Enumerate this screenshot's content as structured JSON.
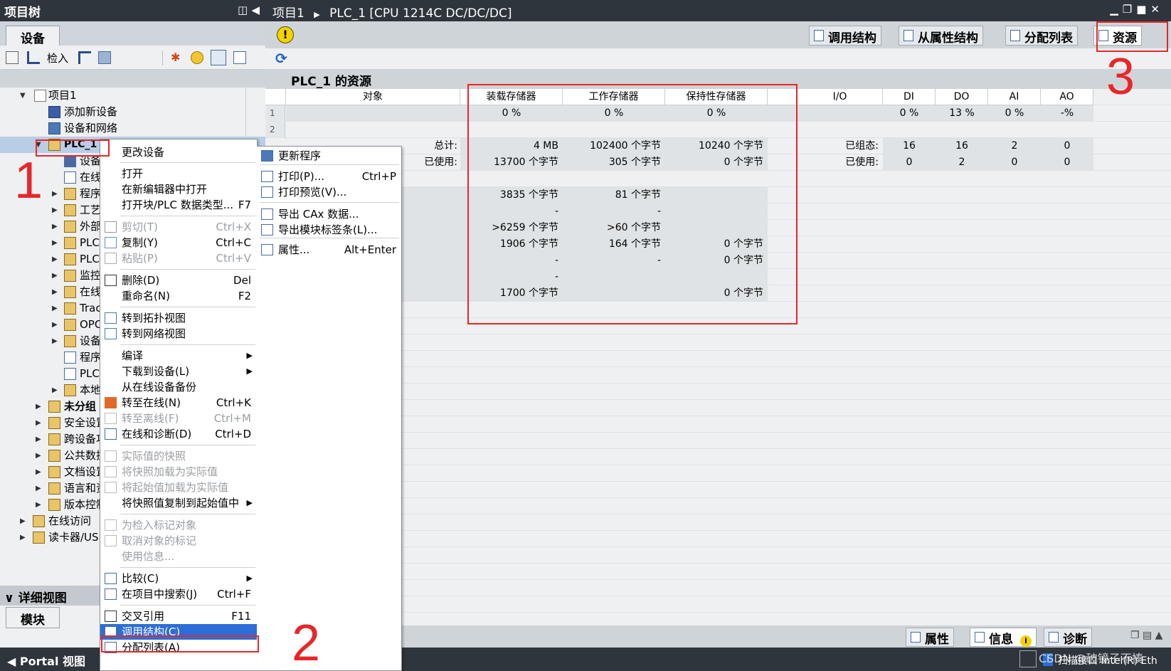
{
  "left_panel": {
    "title": "项目树",
    "tab": "设备",
    "toolbar_checkin": "检入",
    "tree": [
      {
        "label": "项目1"
      },
      {
        "label": "添加新设备"
      },
      {
        "label": "设备和网络"
      },
      {
        "label": "PLC_1 ["
      },
      {
        "label": "设备"
      },
      {
        "label": "在线"
      },
      {
        "label": "程序"
      },
      {
        "label": "工艺"
      },
      {
        "label": "外部"
      },
      {
        "label": "PLC"
      },
      {
        "label": "PLC"
      },
      {
        "label": "监控"
      },
      {
        "label": "在线"
      },
      {
        "label": "Trac"
      },
      {
        "label": "OPC"
      },
      {
        "label": "设备"
      },
      {
        "label": "程序"
      },
      {
        "label": "PLC"
      },
      {
        "label": "本地"
      },
      {
        "label": "未分组"
      },
      {
        "label": "安全设置"
      },
      {
        "label": "跨设备功"
      },
      {
        "label": "公共数据"
      },
      {
        "label": "文档设置"
      },
      {
        "label": "语言和资"
      },
      {
        "label": "版本控制"
      },
      {
        "label": "在线访问"
      },
      {
        "label": "读卡器/USE"
      }
    ],
    "detail_title": "详细视图",
    "detail_tab": "模块",
    "portal_label": "Portal 视图"
  },
  "editor": {
    "breadcrumb_project": "项目1",
    "breadcrumb_device": "PLC_1 [CPU 1214C DC/DC/DC]",
    "tabs": [
      "调用结构",
      "从属性结构",
      "分配列表",
      "资源"
    ],
    "title": "PLC_1 的资源",
    "columns": [
      "对象",
      "装载存储器",
      "工作存储器",
      "保持性存储器",
      "I/O",
      "DI",
      "DO",
      "AI",
      "AO"
    ],
    "row1": {
      "rownum": "1",
      "load": "0 %",
      "work": "0 %",
      "retain": "0 %",
      "di": "0 %",
      "do": "13 %",
      "ai": "0 %",
      "ao": "-%"
    },
    "row2": {
      "rownum": "2"
    },
    "total_label": "总计:",
    "used_label": "已使用:",
    "configured_label": "已组态:",
    "io_used_label": "已使用:",
    "total": {
      "load": "4 MB",
      "work": "102400 个字节",
      "retain": "10240 个字节"
    },
    "used": {
      "load": "13700 个字节",
      "work": "305 个字节",
      "retain": "0 个字节"
    },
    "configured": {
      "di": "16",
      "do": "16",
      "ai": "2",
      "ao": "0"
    },
    "io_used": {
      "di": "0",
      "do": "2",
      "ai": "0",
      "ao": "0"
    },
    "detail_rows": [
      {
        "load": "3835 个字节",
        "work": "81 个字节",
        "retain": ""
      },
      {
        "load": "-",
        "work": "-",
        "retain": ""
      },
      {
        "load": ">6259 个字节",
        "work": ">60 个字节",
        "retain": ""
      },
      {
        "load": "1906 个字节",
        "work": "164 个字节",
        "retain": "0 个字节"
      },
      {
        "load": "-",
        "work": "-",
        "retain": "0 个字节"
      },
      {
        "load": "-",
        "work": "",
        "retain": ""
      },
      {
        "load": "1700 个字节",
        "work": "",
        "retain": "0 个字节"
      }
    ],
    "bottom_tabs": [
      "属性",
      "信息",
      "诊断"
    ],
    "status_text": "扫描接口 Intel(R) Eth"
  },
  "context_menu": [
    {
      "label": "更改设备",
      "shortcut": "",
      "disabled": false
    },
    {
      "label": "打开",
      "shortcut": "",
      "disabled": false
    },
    {
      "label": "在新编辑器中打开",
      "shortcut": "",
      "disabled": false
    },
    {
      "label": "打开块/PLC 数据类型...",
      "shortcut": "F7",
      "disabled": false
    },
    {
      "label": "剪切(T)",
      "shortcut": "Ctrl+X",
      "disabled": true
    },
    {
      "label": "复制(Y)",
      "shortcut": "Ctrl+C",
      "disabled": false
    },
    {
      "label": "粘贴(P)",
      "shortcut": "Ctrl+V",
      "disabled": true
    },
    {
      "label": "删除(D)",
      "shortcut": "Del",
      "disabled": false
    },
    {
      "label": "重命名(N)",
      "shortcut": "F2",
      "disabled": false
    },
    {
      "label": "转到拓扑视图",
      "shortcut": "",
      "disabled": false
    },
    {
      "label": "转到网络视图",
      "shortcut": "",
      "disabled": false
    },
    {
      "label": "编译",
      "shortcut": "",
      "disabled": false
    },
    {
      "label": "下载到设备(L)",
      "shortcut": "",
      "disabled": false
    },
    {
      "label": "从在线设备备份",
      "shortcut": "",
      "disabled": false
    },
    {
      "label": "转至在线(N)",
      "shortcut": "Ctrl+K",
      "disabled": false
    },
    {
      "label": "转至离线(F)",
      "shortcut": "Ctrl+M",
      "disabled": true
    },
    {
      "label": "在线和诊断(D)",
      "shortcut": "Ctrl+D",
      "disabled": false
    },
    {
      "label": "实际值的快照",
      "shortcut": "",
      "disabled": true
    },
    {
      "label": "将快照加载为实际值",
      "shortcut": "",
      "disabled": true
    },
    {
      "label": "将起始值加载为实际值",
      "shortcut": "",
      "disabled": true
    },
    {
      "label": "将快照值复制到起始值中",
      "shortcut": "",
      "disabled": false
    },
    {
      "label": "为检入标记对象",
      "shortcut": "",
      "disabled": true
    },
    {
      "label": "取消对象的标记",
      "shortcut": "",
      "disabled": true
    },
    {
      "label": "使用信息...",
      "shortcut": "",
      "disabled": true
    },
    {
      "label": "比较(C)",
      "shortcut": "",
      "disabled": false
    },
    {
      "label": "在项目中搜索(J)",
      "shortcut": "Ctrl+F",
      "disabled": false
    },
    {
      "label": "交叉引用",
      "shortcut": "F11",
      "disabled": false
    },
    {
      "label": "调用结构(C)",
      "shortcut": "",
      "disabled": false
    },
    {
      "label": "分配列表(A)",
      "shortcut": "",
      "disabled": false
    }
  ],
  "context_menu_right": [
    {
      "label": "更新程序",
      "shortcut": ""
    },
    {
      "label": "打印(P)...",
      "shortcut": "Ctrl+P"
    },
    {
      "label": "打印预览(V)...",
      "shortcut": ""
    },
    {
      "label": "导出 CAx 数据...",
      "shortcut": ""
    },
    {
      "label": "导出模块标签条(L)...",
      "shortcut": ""
    },
    {
      "label": "属性...",
      "shortcut": "Alt+Enter"
    }
  ],
  "annotations": [
    "1",
    "2",
    "3"
  ],
  "watermark": "CSDN @破镜子不揍",
  "colors": {
    "highlight": "#2c6ed6",
    "annotation": "#e8262a",
    "titlebar": "#2f353c"
  }
}
